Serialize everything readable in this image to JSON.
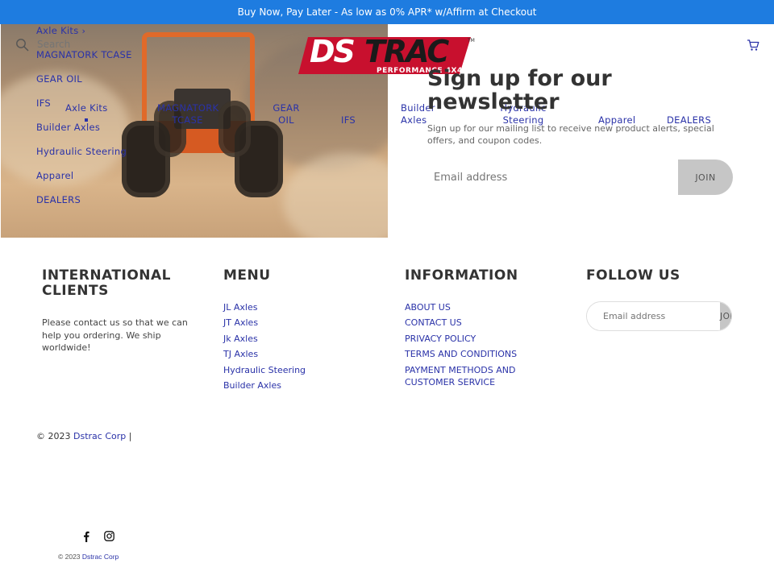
{
  "announcement": "Buy Now, Pay Later - As low as 0% APR* w/Affirm at Checkout",
  "search": {
    "placeholder": "Search"
  },
  "logo": {
    "text": "DSTRAC",
    "tagline": "PERFORMANCE 4X4",
    "tm": "TM"
  },
  "vertical_nav": {
    "items": [
      {
        "label": "Axle Kits"
      },
      {
        "label": "MAGNATORK TCASE"
      },
      {
        "label": "GEAR OIL"
      },
      {
        "label": "IFS"
      },
      {
        "label": "Builder Axles"
      },
      {
        "label": "Hydraulic Steering"
      },
      {
        "label": "Apparel"
      },
      {
        "label": "DEALERS"
      }
    ]
  },
  "horizontal_nav": {
    "items": [
      {
        "line1": "Axle Kits",
        "line2": ""
      },
      {
        "line1": "MAGNATORK",
        "line2": "TCASE"
      },
      {
        "line1": "GEAR",
        "line2": "OIL"
      },
      {
        "line1": "IFS",
        "line2": ""
      },
      {
        "line1": "Builder",
        "line2": "Axles"
      },
      {
        "line1": "Hydraulic",
        "line2": "Steering"
      },
      {
        "line1": "Apparel",
        "line2": ""
      },
      {
        "line1": "DEALERS",
        "line2": ""
      }
    ]
  },
  "newsletter": {
    "title_line1": "Sign up for our",
    "title_line2": "newsletter",
    "text": "Sign up for our mailing list to receive new product alerts, special offers, and coupon codes.",
    "placeholder": "Email address",
    "button": "JOIN"
  },
  "footer": {
    "international": {
      "title_line1": "INTERNATIONAL",
      "title_line2": "CLIENTS",
      "text_line1": "Please contact us so that we can",
      "text_line2": "help you ordering. We ship",
      "text_line3": "worldwide!"
    },
    "menu": {
      "title": "MENU",
      "links": [
        "JL Axles",
        "JT Axles",
        "Jk Axles",
        "TJ Axles",
        "Hydraulic Steering",
        "Builder Axles"
      ]
    },
    "information": {
      "title": "INFORMATION",
      "links": [
        "ABOUT US",
        "CONTACT US",
        "PRIVACY POLICY",
        "TERMS AND CONDITIONS",
        "PAYMENT METHODS AND",
        "CUSTOMER SERVICE"
      ]
    },
    "follow": {
      "title": "FOLLOW US",
      "placeholder": "Email address",
      "button": "JOIN"
    }
  },
  "copyright": {
    "prefix": "© 2023 ",
    "company": "Dstrac Corp",
    "suffix": " |"
  },
  "copyright_bottom": {
    "prefix": "© 2023 ",
    "company": "Dstrac Corp"
  },
  "colors": {
    "announcement_bg": "#1e7ce0",
    "link": "#2a32a8",
    "logo_red": "#c8102e",
    "button_bg": "#c6c6c6"
  }
}
